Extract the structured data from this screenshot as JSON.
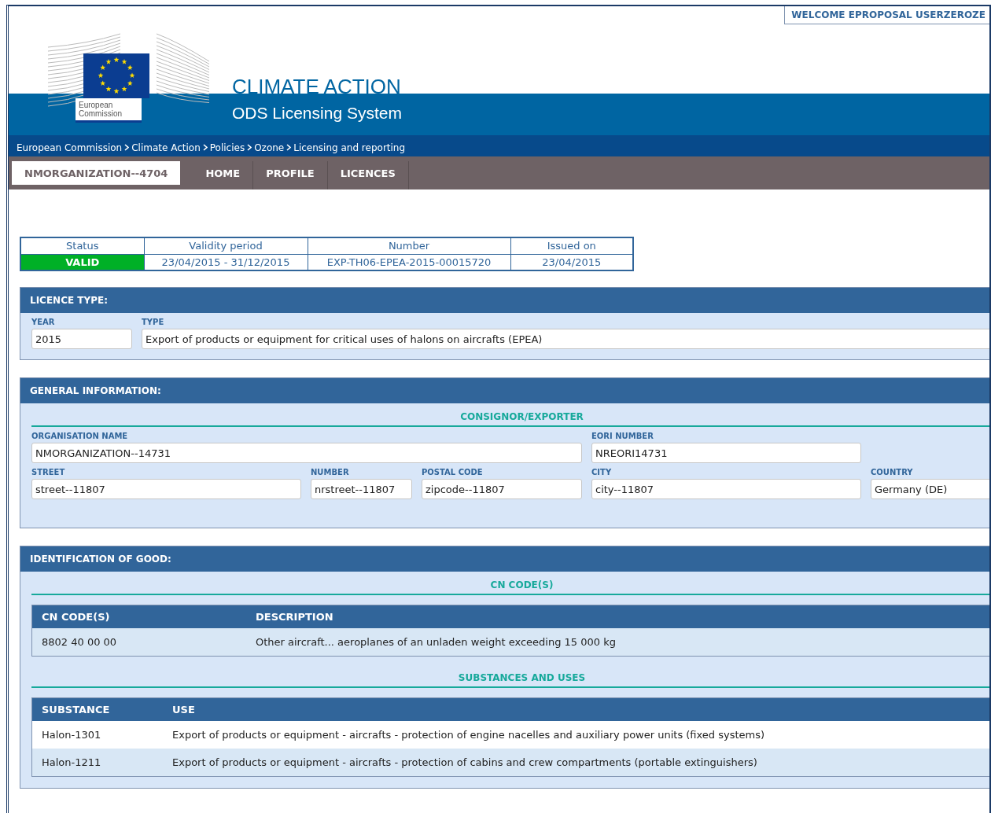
{
  "welcome": "WELCOME EPROPOSAL USERZEROZE",
  "logo": {
    "line1": "European",
    "line2": "Commission"
  },
  "header": {
    "title": "CLIMATE ACTION",
    "subtitle": "ODS Licensing System"
  },
  "breadcrumb": [
    "European Commission",
    "Climate Action",
    "Policies",
    "Ozone",
    "Licensing and reporting"
  ],
  "organization": "NMORGANIZATION--4704",
  "menu": [
    "HOME",
    "PROFILE",
    "LICENCES"
  ],
  "summary": {
    "columns": [
      "Status",
      "Validity period",
      "Number",
      "Issued on"
    ],
    "status": {
      "label": "VALID",
      "color": "#00b026"
    },
    "cells": [
      "23/04/2015 - 31/12/2015",
      "EXP-TH06-EPEA-2015-00015720",
      "23/04/2015"
    ]
  },
  "licence_type": {
    "title": "LICENCE TYPE:",
    "fields": [
      {
        "label": "YEAR",
        "value": "2015"
      },
      {
        "label": "TYPE",
        "value": "Export of products or equipment for critical uses of halons on aircrafts (EPEA)"
      }
    ]
  },
  "general_information": {
    "title": "GENERAL INFORMATION:",
    "subtitle": "CONSIGNOR/EXPORTER",
    "fields": [
      {
        "label": "ORGANISATION NAME",
        "value": "NMORGANIZATION--14731"
      },
      {
        "label": "EORI NUMBER",
        "value": "NREORI14731"
      },
      {
        "label": "STREET",
        "value": "street--11807"
      },
      {
        "label": "NUMBER",
        "value": "nrstreet--11807"
      },
      {
        "label": "POSTAL CODE",
        "value": "zipcode--11807"
      },
      {
        "label": "CITY",
        "value": "city--11807"
      },
      {
        "label": "COUNTRY",
        "value": "Germany (DE)"
      }
    ]
  },
  "identification_of_good": {
    "title": "IDENTIFICATION OF GOOD:",
    "tables": [
      {
        "subtitle": "CN CODE(S)",
        "columns": [
          "CN CODE(S)",
          "DESCRIPTION"
        ],
        "rows": [
          [
            "8802 40 00 00",
            "Other aircraft... aeroplanes of an unladen weight exceeding 15 000 kg"
          ]
        ]
      },
      {
        "subtitle": "SUBSTANCES AND USES",
        "columns": [
          "SUBSTANCE",
          "USE"
        ],
        "rows": [
          [
            "Halon-1301",
            "Export of products or equipment - aircrafts - protection of engine nacelles and auxiliary power units (fixed systems)"
          ],
          [
            "Halon-1211",
            "Export of products or equipment - aircrafts - protection of cabins and crew compartments (portable extinguishers)"
          ]
        ]
      }
    ]
  }
}
